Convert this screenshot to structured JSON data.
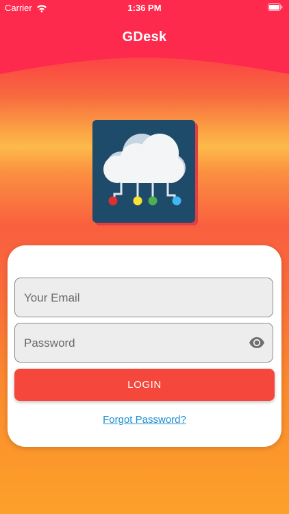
{
  "status_bar": {
    "carrier": "Carrier",
    "time": "1:36 PM",
    "icons": [
      "wifi-icon",
      "battery-icon"
    ]
  },
  "header": {
    "title": "GDesk",
    "color": "#fe2a4d"
  },
  "logo": {
    "icon": "cloud-network-icon",
    "tile_color": "#1f4b6b",
    "node_colors": [
      "#e12f2f",
      "#f6e335",
      "#4caf50",
      "#3db8f2"
    ]
  },
  "login_form": {
    "email_placeholder": "Your Email",
    "password_placeholder": "Password",
    "password_toggle_icon": "eye-icon",
    "login_label": "LOGIN",
    "forgot_label": "Forgot Password?"
  },
  "colors": {
    "login_button": "#f5473c",
    "link": "#1c8fd0"
  }
}
